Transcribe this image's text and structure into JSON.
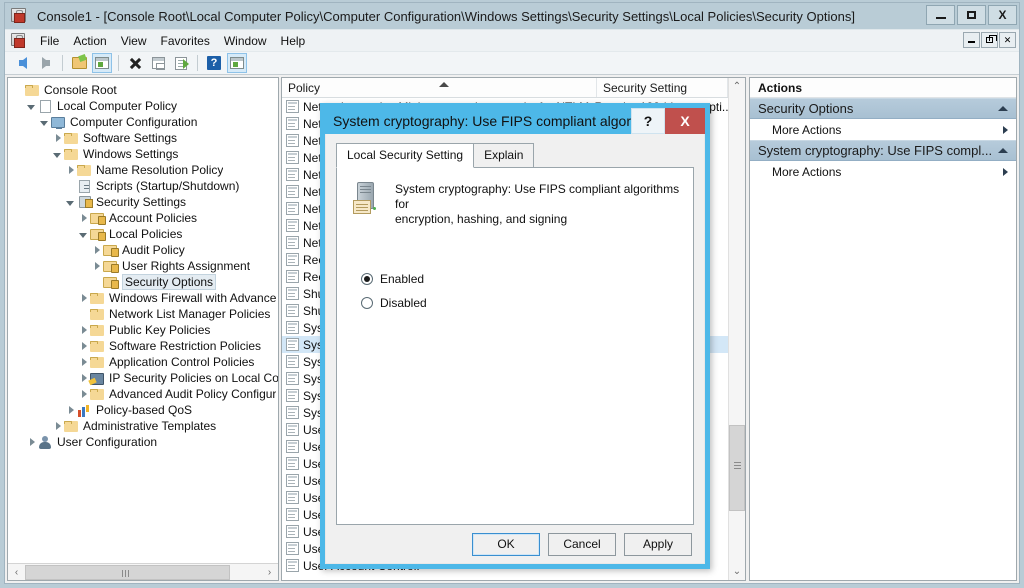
{
  "window": {
    "title": "Console1 - [Console Root\\Local Computer Policy\\Computer Configuration\\Windows Settings\\Security Settings\\Local Policies\\Security Options]",
    "icon": "mmc-console-icon",
    "controls": {
      "minimize": "–",
      "maximize": "□",
      "close": "X"
    },
    "mdi_controls": {
      "minimize": "_",
      "restore": "❐",
      "close": "✕"
    }
  },
  "menu": {
    "items": [
      {
        "label": "File"
      },
      {
        "label": "Action"
      },
      {
        "label": "View"
      },
      {
        "label": "Favorites"
      },
      {
        "label": "Window"
      },
      {
        "label": "Help"
      }
    ]
  },
  "toolbar": {
    "buttons": [
      {
        "name": "back-icon",
        "kind": "arrow-l",
        "selected": false
      },
      {
        "name": "forward-icon",
        "kind": "arrow-r",
        "selected": false
      },
      {
        "name": "up-one-level-icon",
        "kind": "folder",
        "selected": false
      },
      {
        "name": "show-hide-console-tree-icon",
        "kind": "window",
        "selected": true
      },
      {
        "name": "delete-icon",
        "kind": "x",
        "selected": false
      },
      {
        "name": "properties-icon",
        "kind": "doc",
        "selected": false
      },
      {
        "name": "export-list-icon",
        "kind": "export",
        "selected": false
      },
      {
        "name": "help-icon",
        "kind": "help",
        "selected": false
      },
      {
        "name": "show-action-pane-icon",
        "kind": "window",
        "selected": true
      }
    ]
  },
  "tree": {
    "nodes": [
      {
        "label": "Console Root",
        "indent": 0,
        "twist": "none",
        "icon": "folder",
        "selected": false
      },
      {
        "label": "Local Computer Policy",
        "indent": 1,
        "twist": "open",
        "icon": "doc",
        "selected": false
      },
      {
        "label": "Computer Configuration",
        "indent": 2,
        "twist": "open",
        "icon": "monitor",
        "selected": false
      },
      {
        "label": "Software Settings",
        "indent": 3,
        "twist": "closed",
        "icon": "folder",
        "selected": false
      },
      {
        "label": "Windows Settings",
        "indent": 3,
        "twist": "open",
        "icon": "folder",
        "selected": false
      },
      {
        "label": "Name Resolution Policy",
        "indent": 4,
        "twist": "closed",
        "icon": "folder",
        "selected": false
      },
      {
        "label": "Scripts (Startup/Shutdown)",
        "indent": 4,
        "twist": "none",
        "icon": "script",
        "selected": false
      },
      {
        "label": "Security Settings",
        "indent": 4,
        "twist": "open",
        "icon": "security",
        "selected": false
      },
      {
        "label": "Account Policies",
        "indent": 5,
        "twist": "closed",
        "icon": "folder-lock",
        "selected": false
      },
      {
        "label": "Local Policies",
        "indent": 5,
        "twist": "open",
        "icon": "folder-lock",
        "selected": false
      },
      {
        "label": "Audit Policy",
        "indent": 6,
        "twist": "closed",
        "icon": "folder-lock",
        "selected": false
      },
      {
        "label": "User Rights Assignment",
        "indent": 6,
        "twist": "closed",
        "icon": "folder-lock",
        "selected": false
      },
      {
        "label": "Security Options",
        "indent": 6,
        "twist": "none",
        "icon": "folder-lock",
        "selected": true
      },
      {
        "label": "Windows Firewall with Advance",
        "indent": 5,
        "twist": "closed",
        "icon": "folder",
        "selected": false
      },
      {
        "label": "Network List Manager Policies",
        "indent": 5,
        "twist": "none",
        "icon": "folder",
        "selected": false
      },
      {
        "label": "Public Key Policies",
        "indent": 5,
        "twist": "closed",
        "icon": "folder",
        "selected": false
      },
      {
        "label": "Software Restriction Policies",
        "indent": 5,
        "twist": "closed",
        "icon": "folder",
        "selected": false
      },
      {
        "label": "Application Control Policies",
        "indent": 5,
        "twist": "closed",
        "icon": "folder",
        "selected": false
      },
      {
        "label": "IP Security Policies on Local Cor",
        "indent": 5,
        "twist": "closed",
        "icon": "ipsec",
        "selected": false
      },
      {
        "label": "Advanced Audit Policy Configur",
        "indent": 5,
        "twist": "closed",
        "icon": "folder",
        "selected": false
      },
      {
        "label": "Policy-based QoS",
        "indent": 4,
        "twist": "closed",
        "icon": "qos",
        "selected": false
      },
      {
        "label": "Administrative Templates",
        "indent": 3,
        "twist": "closed",
        "icon": "folder",
        "selected": false
      },
      {
        "label": "User Configuration",
        "indent": 1,
        "twist": "closed",
        "icon": "user",
        "selected": false
      }
    ],
    "hscroll": {
      "left_arrow": "‹",
      "right_arrow": "›"
    }
  },
  "list": {
    "columns": [
      {
        "label": "Policy",
        "sorted": true
      },
      {
        "label": "Security Setting",
        "sorted": false
      }
    ],
    "rows": [
      {
        "policy": "Network security: Minimum session security for NTLM SSP",
        "setting": "Require 128-bit encrypti...",
        "selected": false
      },
      {
        "policy": "Network security:",
        "setting": "",
        "selected": false
      },
      {
        "policy": "Network security:",
        "setting": "",
        "selected": false
      },
      {
        "policy": "Network security:",
        "setting": "",
        "selected": false
      },
      {
        "policy": "Network security:",
        "setting": "",
        "selected": false
      },
      {
        "policy": "Network security:",
        "setting": "",
        "selected": false
      },
      {
        "policy": "Network security:",
        "setting": "",
        "selected": false
      },
      {
        "policy": "Network security:",
        "setting": "",
        "selected": false
      },
      {
        "policy": "Network security:",
        "setting": "",
        "selected": false
      },
      {
        "policy": "Recovery console:",
        "setting": "",
        "selected": false
      },
      {
        "policy": "Recovery console:",
        "setting": "",
        "selected": false
      },
      {
        "policy": "Shutdown:",
        "setting": "",
        "selected": false
      },
      {
        "policy": "Shutdown:",
        "setting": "",
        "selected": false
      },
      {
        "policy": "System cryptography:",
        "setting": "",
        "selected": false
      },
      {
        "policy": "System cryptography: Use FIPS compliant algorithms",
        "setting": "",
        "selected": true
      },
      {
        "policy": "System objects:",
        "setting": "",
        "selected": false
      },
      {
        "policy": "System objects:",
        "setting": "",
        "selected": false
      },
      {
        "policy": "System settings:",
        "setting": "",
        "selected": false
      },
      {
        "policy": "System settings:",
        "setting": "",
        "selected": false
      },
      {
        "policy": "User Account Control:",
        "setting": "",
        "selected": false
      },
      {
        "policy": "User Account Control:",
        "setting": "",
        "selected": false
      },
      {
        "policy": "User Account Control:",
        "setting": "",
        "selected": false
      },
      {
        "policy": "User Account Control:",
        "setting": "",
        "selected": false
      },
      {
        "policy": "User Account Control:",
        "setting": "",
        "selected": false
      },
      {
        "policy": "User Account Control:",
        "setting": "",
        "selected": false
      },
      {
        "policy": "User Account Control:",
        "setting": "",
        "selected": false
      },
      {
        "policy": "User Account Control:",
        "setting": "",
        "selected": false
      },
      {
        "policy": "User Account Control:",
        "setting": "",
        "selected": false
      }
    ],
    "vscroll": {
      "up_arrow": "⌃",
      "down_arrow": "⌄"
    }
  },
  "actions": {
    "title": "Actions",
    "groups": [
      {
        "label": "Security Options",
        "collapse_icon": "caret-up-icon",
        "items": [
          {
            "label": "More Actions",
            "submenu_icon": "caret-right-icon"
          }
        ]
      },
      {
        "label": "System cryptography: Use FIPS compl...",
        "collapse_icon": "caret-up-icon",
        "items": [
          {
            "label": "More Actions",
            "submenu_icon": "caret-right-icon"
          }
        ]
      }
    ]
  },
  "dialog": {
    "title": "System cryptography: Use FIPS compliant algorith...",
    "help_label": "?",
    "close_label": "X",
    "tabs": [
      {
        "label": "Local Security Setting",
        "active": true
      },
      {
        "label": "Explain",
        "active": false
      }
    ],
    "policy_icon": "server-policy-icon",
    "policy_name_line1": "System cryptography: Use FIPS compliant algorithms for",
    "policy_name_line2": "encryption, hashing, and signing",
    "options": [
      {
        "label": "Enabled",
        "selected": true
      },
      {
        "label": "Disabled",
        "selected": false
      }
    ],
    "buttons": [
      {
        "label": "OK",
        "focused": true
      },
      {
        "label": "Cancel",
        "focused": false
      },
      {
        "label": "Apply",
        "focused": false
      }
    ]
  }
}
